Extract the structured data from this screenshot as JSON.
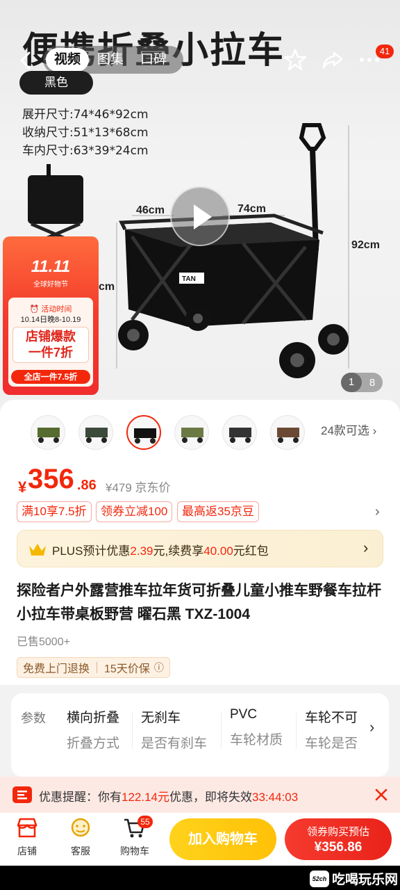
{
  "hero": {
    "heading": "便携折叠小拉车",
    "media_tabs": [
      "视频",
      "图集",
      "口碑"
    ],
    "cart_badge_count": "41",
    "color_label": "黑色",
    "specs": [
      "展开尺寸:74*46*92cm",
      "收纳尺寸:51*13*68cm",
      "车内尺寸:63*39*24cm"
    ],
    "dim_labels": {
      "width": "46cm",
      "length": "74cm",
      "height": "92cm",
      "side": "cm"
    },
    "page_current": "1",
    "page_total": "8",
    "promo": {
      "logo": "11.11",
      "subtitle": "全球好物节",
      "time_label": "活动时间",
      "date": "10.14日晚8-10.19",
      "big_line1": "店铺爆款",
      "big_line2": "一件7折",
      "footer": "全店一件7.5折"
    }
  },
  "product": {
    "variants_count": "24款可选",
    "price_currency": "¥",
    "price_int": "356",
    "price_dec": ".86",
    "orig_price": "¥479 京东价",
    "promo_tags": [
      "满10享7.5折",
      "领券立减100",
      "最高返35京豆"
    ],
    "plus": {
      "prefix": "PLUS预计优惠",
      "amount": "2.39",
      "mid": "元,续费享",
      "amount2": "40.00",
      "suffix": "元红包"
    },
    "title": "探险者户外露营推车拉年货可折叠儿童小推车野餐车拉杆小拉车带桌板野营 曜石黑 TXZ-1004",
    "sold": "已售5000+",
    "services": [
      "免费上门退换",
      "15天价保"
    ]
  },
  "params": {
    "header": "参数",
    "items": [
      {
        "value": "横向折叠",
        "key": "折叠方式"
      },
      {
        "value": "无刹车",
        "key": "是否有刹车"
      },
      {
        "value": "PVC",
        "key": "车轮材质"
      },
      {
        "value": "车轮不可",
        "key": "车轮是否"
      }
    ]
  },
  "reminder": {
    "prefix": "优惠提醒：你有",
    "amount": "122.14元",
    "mid": "优惠，即将失效",
    "countdown": "33:44:03"
  },
  "bottom_bar": {
    "store": "店铺",
    "service": "客服",
    "cart": "购物车",
    "cart_count": "55",
    "add_cart": "加入购物车",
    "buy_line1": "领券购买预估",
    "buy_line2": "¥356.86"
  },
  "watermark": {
    "logo": "52ch",
    "text": "吃喝玩乐网"
  },
  "colors": {
    "accent": "#f2270c",
    "gold": "#ffc107"
  }
}
